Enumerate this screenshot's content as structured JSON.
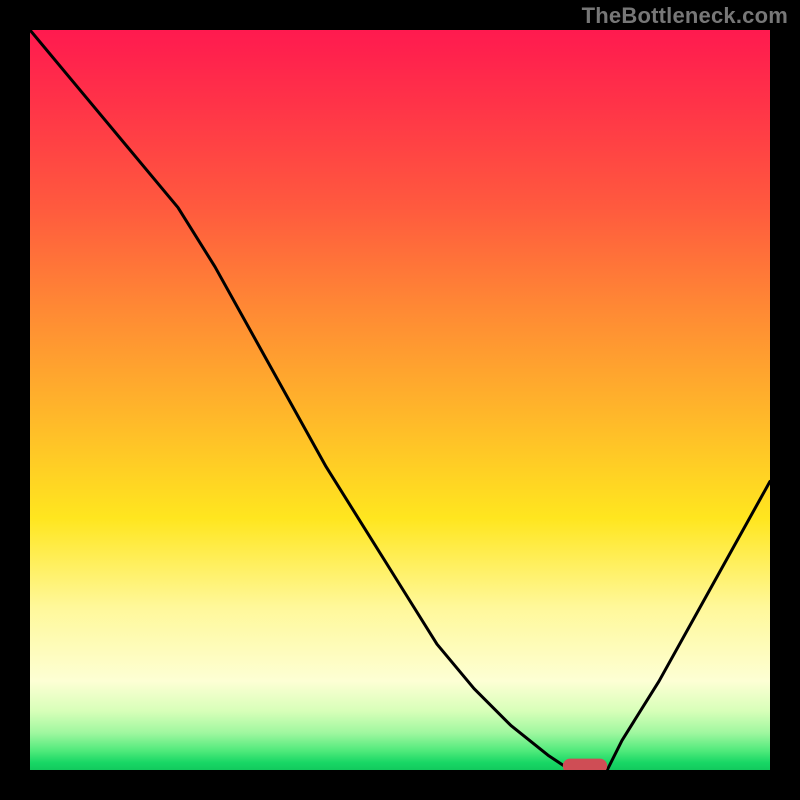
{
  "watermark": "TheBottleneck.com",
  "colors": {
    "background": "#000000",
    "curve": "#000000",
    "marker": "#cf4d55"
  },
  "chart_data": {
    "type": "line",
    "title": "",
    "xlabel": "",
    "ylabel": "",
    "xlim": [
      0,
      100
    ],
    "ylim": [
      0,
      100
    ],
    "grid": false,
    "legend": false,
    "series": [
      {
        "name": "bottleneck-curve",
        "x": [
          0,
          5,
          10,
          15,
          20,
          25,
          30,
          35,
          40,
          45,
          50,
          55,
          60,
          65,
          70,
          73,
          75,
          78,
          80,
          85,
          90,
          95,
          100
        ],
        "y": [
          100,
          94,
          88,
          82,
          76,
          68,
          59,
          50,
          41,
          33,
          25,
          17,
          11,
          6,
          2,
          0,
          0,
          0,
          4,
          12,
          21,
          30,
          39
        ]
      }
    ],
    "marker": {
      "x": 75,
      "y": 0,
      "width": 6,
      "height": 2
    },
    "gradient_stops": [
      {
        "pos": 0,
        "color": "#ff1a4f"
      },
      {
        "pos": 0.1,
        "color": "#ff3348"
      },
      {
        "pos": 0.24,
        "color": "#ff5a3e"
      },
      {
        "pos": 0.38,
        "color": "#ff8a34"
      },
      {
        "pos": 0.52,
        "color": "#ffb72a"
      },
      {
        "pos": 0.66,
        "color": "#ffe61f"
      },
      {
        "pos": 0.78,
        "color": "#fff89a"
      },
      {
        "pos": 0.88,
        "color": "#fdffd4"
      },
      {
        "pos": 0.92,
        "color": "#d8ffb9"
      },
      {
        "pos": 0.95,
        "color": "#9ff79f"
      },
      {
        "pos": 0.975,
        "color": "#4de97a"
      },
      {
        "pos": 0.99,
        "color": "#18d765"
      },
      {
        "pos": 1.0,
        "color": "#12c95d"
      }
    ]
  }
}
